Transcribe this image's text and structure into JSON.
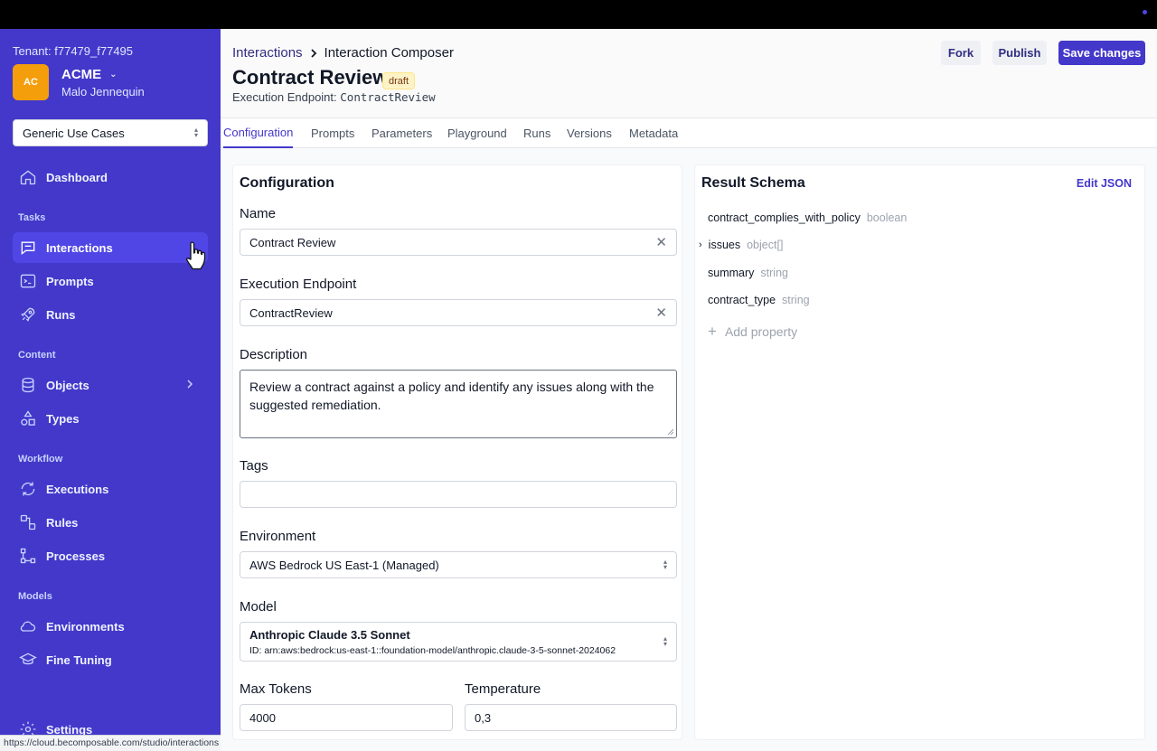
{
  "sidebar": {
    "tenant": "Tenant: f77479_f77495",
    "org_initials": "AC",
    "org_name": "ACME",
    "user_name": "Malo Jennequin",
    "project_select": "Generic Use Cases",
    "items": {
      "dashboard": "Dashboard",
      "interactions": "Interactions",
      "prompts": "Prompts",
      "runs": "Runs",
      "objects": "Objects",
      "types": "Types",
      "executions": "Executions",
      "rules": "Rules",
      "processes": "Processes",
      "environments": "Environments",
      "fine_tuning": "Fine Tuning",
      "settings": "Settings"
    },
    "sections": {
      "tasks": "Tasks",
      "content": "Content",
      "workflow": "Workflow",
      "models": "Models"
    },
    "active_item": "Interactions"
  },
  "status_url": "https://cloud.becomposable.com/studio/interactions",
  "header": {
    "breadcrumb_root": "Interactions",
    "breadcrumb_current": "Interaction Composer",
    "title": "Contract Review",
    "badge": "draft",
    "endpoint_label": "Execution Endpoint:",
    "endpoint_value": "ContractReview",
    "fork_label": "Fork",
    "publish_label": "Publish",
    "save_label": "Save changes"
  },
  "tabs": [
    "Configuration",
    "Prompts",
    "Parameters",
    "Playground",
    "Runs",
    "Versions",
    "Metadata"
  ],
  "active_tab": "Configuration",
  "config": {
    "title": "Configuration",
    "name_label": "Name",
    "name_value": "Contract Review",
    "endpoint_label": "Execution Endpoint",
    "endpoint_value": "ContractReview",
    "description_label": "Description",
    "description_value": "Review a contract against a policy and identify any issues along with the suggested remediation.",
    "tags_label": "Tags",
    "tags_value": "",
    "environment_label": "Environment",
    "environment_value": "AWS Bedrock US East-1 (Managed)",
    "model_label": "Model",
    "model_name": "Anthropic Claude 3.5 Sonnet",
    "model_id": "ID: arn:aws:bedrock:us-east-1::foundation-model/anthropic.claude-3-5-sonnet-2024062",
    "max_tokens_label": "Max Tokens",
    "max_tokens_value": "4000",
    "temperature_label": "Temperature",
    "temperature_value": "0,3"
  },
  "schema": {
    "title": "Result Schema",
    "edit_json_label": "Edit JSON",
    "properties": [
      {
        "name": "contract_complies_with_policy",
        "type": "boolean"
      },
      {
        "name": "issues",
        "type": "object[]"
      },
      {
        "name": "summary",
        "type": "string"
      },
      {
        "name": "contract_type",
        "type": "string"
      }
    ],
    "add_property_label": "Add property"
  },
  "colors": {
    "sidebar": "#4338ca",
    "accent": "#4338ca",
    "avatar": "#f59e0b"
  }
}
